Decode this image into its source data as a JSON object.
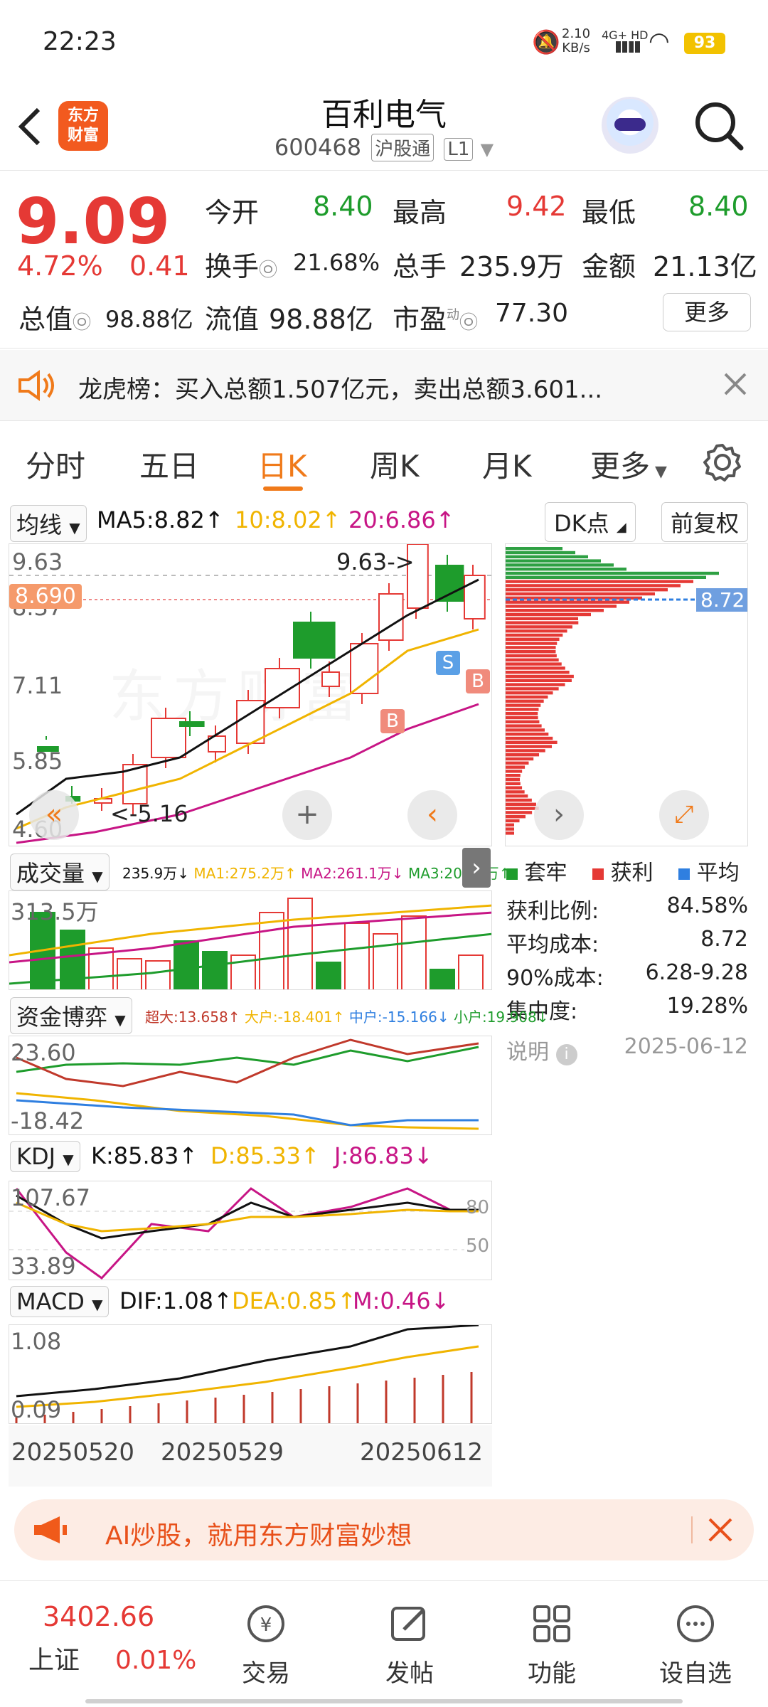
{
  "status_bar": {
    "time": "22:23",
    "net_speed_value": "2.10",
    "net_speed_unit": "KB/s",
    "network": "4G+ HD",
    "battery": "93"
  },
  "header": {
    "logo_line1": "东方",
    "logo_line2": "财富",
    "title": "百利电气",
    "code": "600468",
    "tag1": "沪股通",
    "tag2": "L1"
  },
  "quote": {
    "price": "9.09",
    "change_pct": "4.72%",
    "change": "0.41",
    "open_label": "今开",
    "open": "8.40",
    "high_label": "最高",
    "high": "9.42",
    "low_label": "最低",
    "low": "8.40",
    "turnover_label": "换手",
    "turnover": "21.68%",
    "volume_label": "总手",
    "volume": "235.9万",
    "amount_label": "金额",
    "amount": "21.13亿",
    "mktcap_label": "总值",
    "mktcap": "98.88亿",
    "float_label": "流值",
    "float_cap": "98.88亿",
    "pe_label": "市盈",
    "pe_sup": "动",
    "pe": "77.30",
    "more_label": "更多"
  },
  "lhb": {
    "text": "龙虎榜：买入总额1.507亿元，卖出总额3.601..."
  },
  "tabs": [
    "分时",
    "五日",
    "日K",
    "周K",
    "月K",
    "更多"
  ],
  "active_tab": "日K",
  "kline": {
    "ma_selector": "均线",
    "ma5": "MA5:8.82↑",
    "ma10": "10:8.02↑",
    "ma20": "20:6.86↑",
    "dk_label": "DK点",
    "adjust_label": "前复权",
    "y_labels": [
      "9.63",
      "8.37",
      "7.11",
      "5.85",
      "4.60"
    ],
    "current_tag": "8.690",
    "high_note": "9.63->",
    "low_note": "<-5.16",
    "marker_b": "B",
    "marker_s": "S",
    "watermark": "东方财富"
  },
  "chip": {
    "cost_tag": "8.72",
    "legend": [
      "套牢",
      "获利",
      "平均"
    ],
    "rows": [
      {
        "label": "获利比例:",
        "value": "84.58%"
      },
      {
        "label": "平均成本:",
        "value": "8.72"
      },
      {
        "label": "90%成本:",
        "value": "6.28-9.28"
      },
      {
        "label": "集中度:",
        "value": "19.28%"
      }
    ],
    "note_label": "说明",
    "date": "2025-06-12"
  },
  "volume": {
    "selector": "成交量",
    "vol": "235.9万↓",
    "ma1": "MA1:275.2万↑",
    "ma2": "MA2:261.1万↓",
    "ma3": "MA3:208.8万↑",
    "y_label": "313.5万"
  },
  "capital": {
    "selector": "资金博弈",
    "super": "超大:13.658↑",
    "large": "大户:-18.401↑",
    "mid": "中户:-15.166↓",
    "small": "小户:19.908↓",
    "y_top": "23.60",
    "y_bottom": "-18.42"
  },
  "kdj": {
    "selector": "KDJ",
    "k": "K:85.83↑",
    "d": "D:85.33↑",
    "j": "J:86.83↓",
    "y_top": "107.67",
    "y_bottom": "33.89",
    "level80": "80",
    "level50": "50"
  },
  "macd": {
    "selector": "MACD",
    "dif": "DIF:1.08↑",
    "dea": "DEA:0.85↑",
    "m": "M:0.46↓",
    "y_top": "1.08",
    "y_bottom": "0.09"
  },
  "dates": [
    "20250520",
    "20250529",
    "20250612"
  ],
  "ai_banner": {
    "text": "AI炒股，就用东方财富妙想"
  },
  "bottom_nav": {
    "index_value": "3402.66",
    "index_name": "上证",
    "index_change": "0.01%",
    "items": [
      "交易",
      "发帖",
      "功能",
      "设自选"
    ]
  },
  "colors": {
    "up": "#e53935",
    "down": "#1e9c2c",
    "accent": "#f07a1a",
    "ma5": "#111111",
    "ma10": "#f0b400",
    "ma20": "#c71585"
  }
}
